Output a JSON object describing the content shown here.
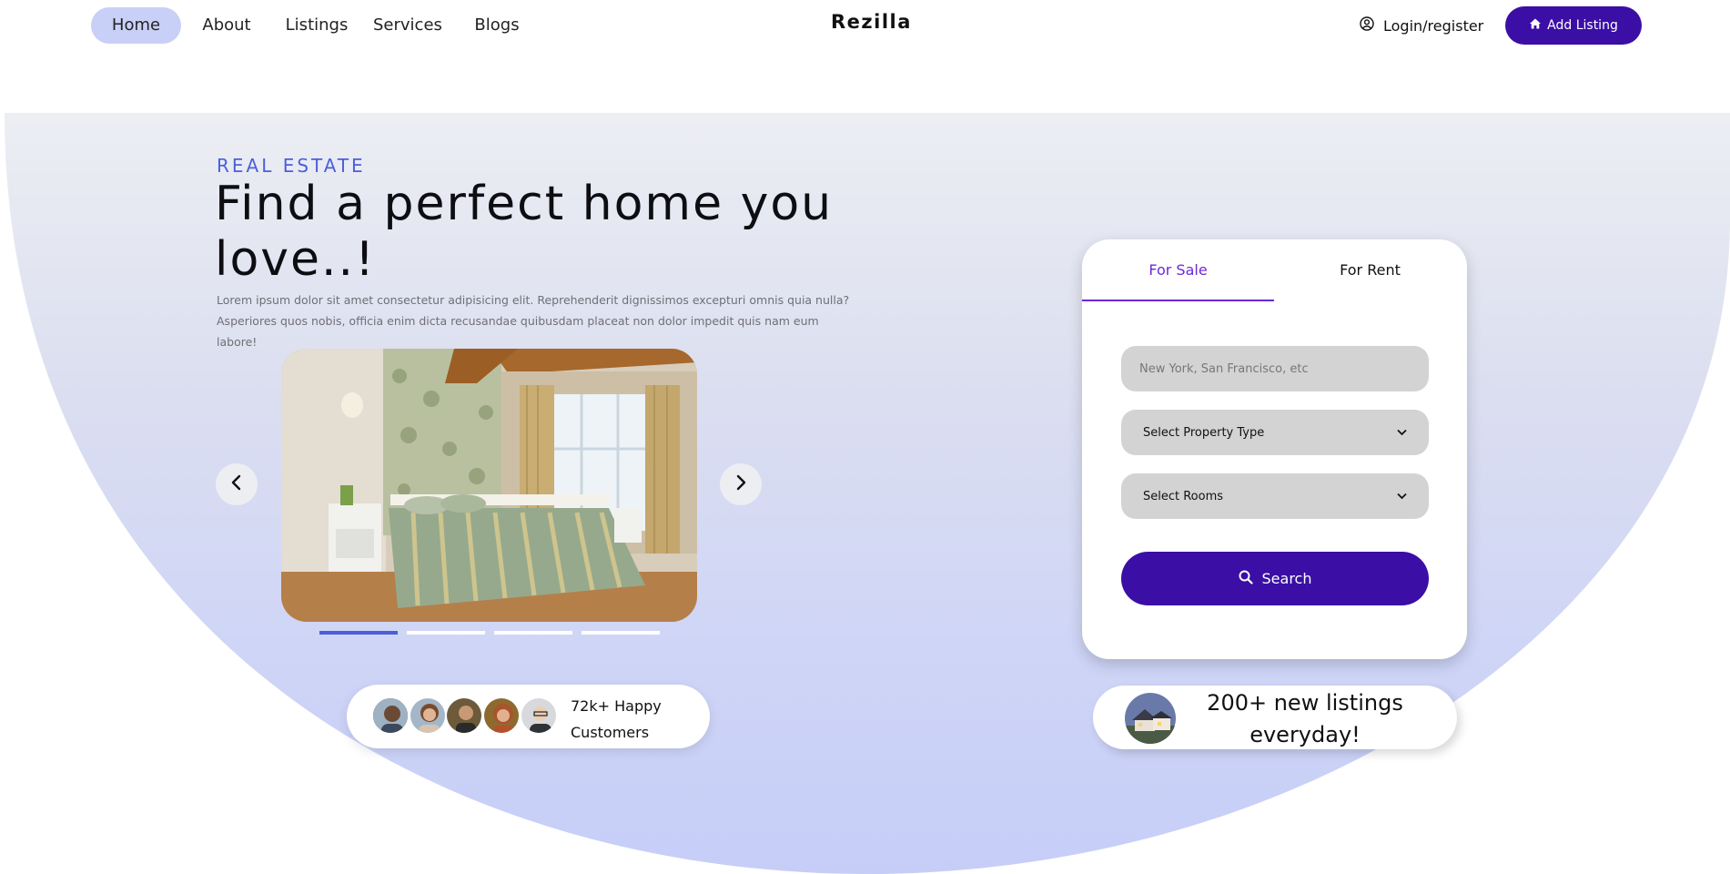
{
  "nav": {
    "items": [
      {
        "label": "Home",
        "active": true
      },
      {
        "label": "About",
        "active": false
      },
      {
        "label": "Listings",
        "active": false
      },
      {
        "label": "Services",
        "active": false
      },
      {
        "label": "Blogs",
        "active": false
      }
    ],
    "brand": "Rezilla",
    "login_label": "Login/register",
    "add_listing_label": "Add Listing"
  },
  "hero": {
    "eyebrow": "REAL ESTATE",
    "title": "Find a perfect home you love..!",
    "description": "Lorem ipsum dolor sit amet consectetur adipisicing elit. Reprehenderit dignissimos excepturi omnis quia nulla? Asperiores quos nobis, officia enim dicta recusandae quibusdam placeat non dolor impedit quis nam eum labore!"
  },
  "carousel": {
    "slide_count": 4,
    "active_slide": 1
  },
  "happy_customers": {
    "label": "72k+ Happy Customers",
    "avatar_count": 5
  },
  "search": {
    "tabs": [
      {
        "label": "For Sale",
        "active": true
      },
      {
        "label": "For Rent",
        "active": false
      }
    ],
    "location_placeholder": "New York, San Francisco, etc",
    "property_type": "Select Property Type",
    "rooms": "Select Rooms",
    "button_label": "Search"
  },
  "new_listings": {
    "label": "200+ new listings everyday!"
  },
  "colors": {
    "accent": "#3b0ea6",
    "eyebrow": "#4b5fd9",
    "active_tab": "#6d28d9",
    "nav_active_bg": "#c9d0f7"
  }
}
